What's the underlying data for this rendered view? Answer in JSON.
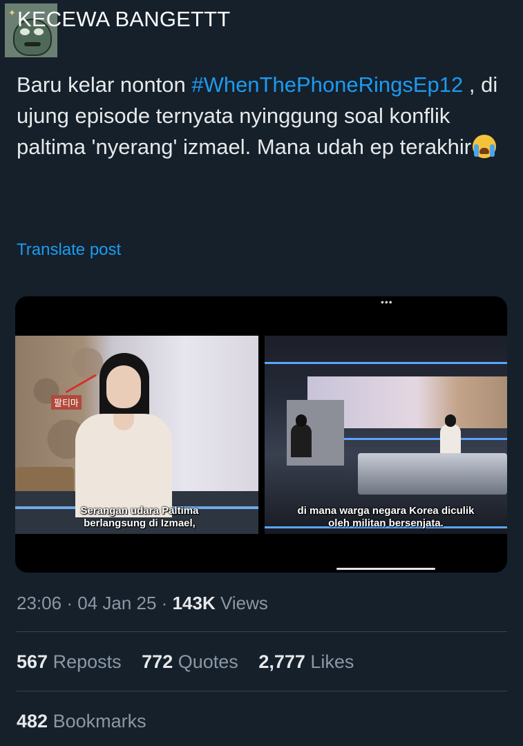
{
  "author": {
    "display_name": "KECEWA BANGETTT",
    "avatar_icon": "cartoon-avatar-icon"
  },
  "tweet": {
    "text_before": "Baru kelar nonton ",
    "hashtag": "#WhenThePhoneRingsEp12",
    "text_after": " , di ujung episode ternyata nyinggung soal konflik paltima 'nyerang' izmael. Mana udah ep terakhir",
    "emoji": "loudly-crying-face-emoji",
    "translate_label": "Translate post"
  },
  "media": {
    "images": [
      {
        "subtitle_line1": "Serangan udara Paltima",
        "subtitle_line2": "berlangsung di Izmael,",
        "map_label": "팔티마"
      },
      {
        "subtitle_line1": "di mana warga negara Korea diculik",
        "subtitle_line2": "oleh militan bersenjata.",
        "top_indicator": "•••"
      }
    ]
  },
  "meta": {
    "time": "23:06",
    "date": "04 Jan 25",
    "separator": "·",
    "views_count": "143K",
    "views_label": "Views"
  },
  "stats": {
    "reposts_count": "567",
    "reposts_label": "Reposts",
    "quotes_count": "772",
    "quotes_label": "Quotes",
    "likes_count": "2,777",
    "likes_label": "Likes",
    "bookmarks_count": "482",
    "bookmarks_label": "Bookmarks"
  },
  "colors": {
    "background": "#15202b",
    "text": "#e7e9ea",
    "accent": "#1d9bf0",
    "secondary": "#8b98a5",
    "divider": "#38444d"
  }
}
